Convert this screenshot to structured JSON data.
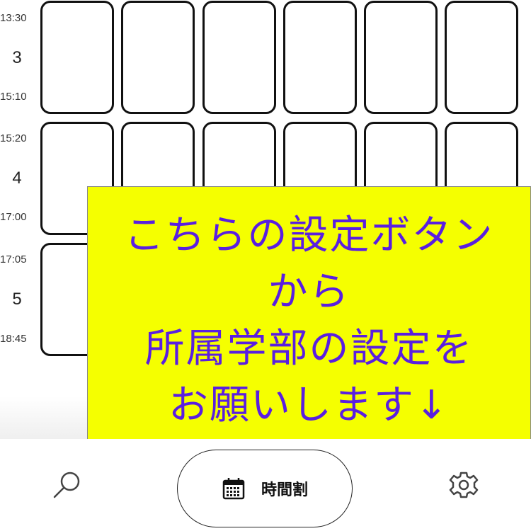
{
  "timetable": {
    "periods": [
      {
        "number": "3",
        "start": "13:30",
        "end": "15:10"
      },
      {
        "number": "4",
        "start": "15:20",
        "end": "17:00"
      },
      {
        "number": "5",
        "start": "17:05",
        "end": "18:45"
      }
    ]
  },
  "banner": {
    "lines": [
      "こちらの設定ボタン",
      "から",
      "所属学部の設定を",
      "お願いします↓"
    ],
    "background": "#f5ff00",
    "text_color": "#5a1fe0"
  },
  "nav": {
    "search_icon": "search-icon",
    "timetable_icon": "calendar-icon",
    "timetable_label": "時間割",
    "settings_icon": "gear-icon"
  }
}
